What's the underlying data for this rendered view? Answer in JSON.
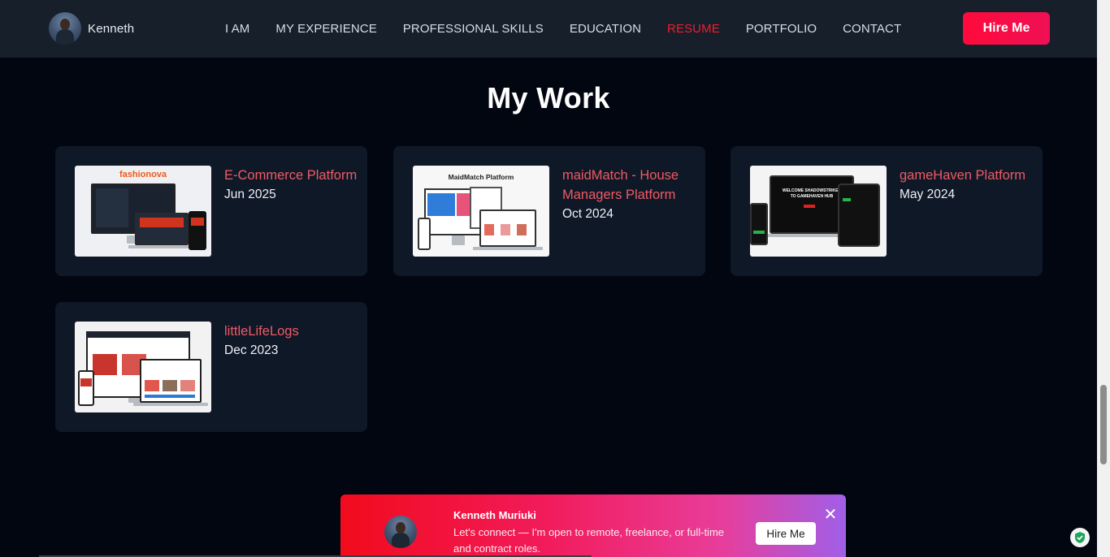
{
  "navbar": {
    "brand_name": "Kenneth",
    "links": [
      {
        "label": "I AM",
        "active": false
      },
      {
        "label": "MY EXPERIENCE",
        "active": false
      },
      {
        "label": "PROFESSIONAL SKILLS",
        "active": false
      },
      {
        "label": "EDUCATION",
        "active": false
      },
      {
        "label": "RESUME",
        "active": true
      },
      {
        "label": "PORTFOLIO",
        "active": false
      },
      {
        "label": "CONTACT",
        "active": false
      }
    ],
    "hire_label": "Hire Me"
  },
  "section": {
    "title": "My Work",
    "projects": [
      {
        "title": "E-Commerce Platform",
        "date": "Jun 2025",
        "thumb_text": "fashionova"
      },
      {
        "title": "maidMatch - House Managers Platform",
        "date": "Oct 2024",
        "thumb_text": "MaidMatch Platform"
      },
      {
        "title": "gameHaven Platform",
        "date": "May 2024",
        "thumb_text": "WELCOME SHADOWSTRIKER TO GAMEHAVEN HUB"
      },
      {
        "title": "littleLifeLogs",
        "date": "Dec 2023",
        "thumb_text": ""
      }
    ]
  },
  "popup": {
    "name": "Kenneth Muriuki",
    "message": "Let's connect — I'm open to remote, freelance, or full-time and contract roles.",
    "button_label": "Hire Me",
    "close_symbol": "✕"
  },
  "colors": {
    "background": "#020611",
    "navbar": "#161f2a",
    "card": "#0f1827",
    "accent": "#ef1f2f",
    "project_title": "#ef5a64"
  }
}
